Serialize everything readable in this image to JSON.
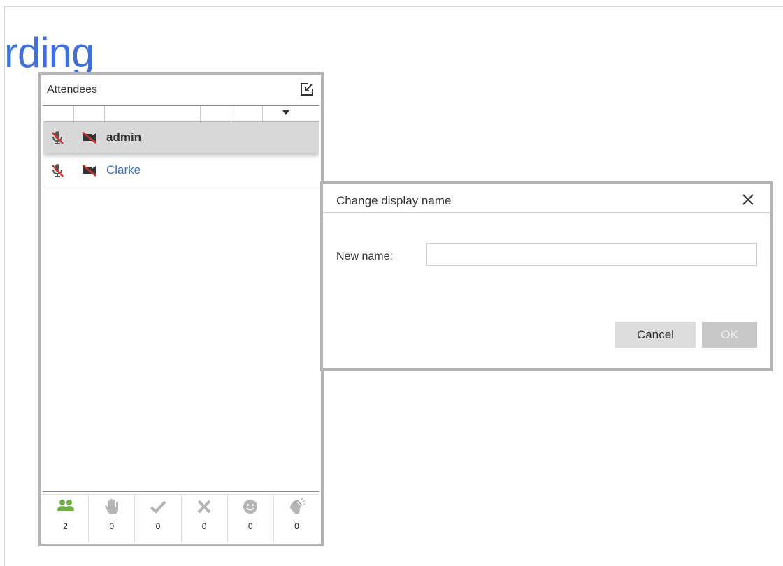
{
  "background": {
    "heading_fragment": "rding"
  },
  "attendees_panel": {
    "title": "Attendees",
    "attendees": [
      {
        "name": "admin",
        "selected": true,
        "mic": "mic-muted",
        "camera": "camera-off"
      },
      {
        "name": "Clarke",
        "selected": false,
        "mic": "mic-muted",
        "camera": "camera-off"
      }
    ],
    "status_counts": [
      {
        "icon": "attendees-icon",
        "count": "2",
        "color": "#6cb33f"
      },
      {
        "icon": "raise-hand-icon",
        "count": "0"
      },
      {
        "icon": "agree-check-icon",
        "count": "0"
      },
      {
        "icon": "disagree-x-icon",
        "count": "0"
      },
      {
        "icon": "smiley-icon",
        "count": "0"
      },
      {
        "icon": "applause-icon",
        "count": "0"
      }
    ]
  },
  "dialog": {
    "title": "Change display name",
    "field_label": "New name:",
    "field_value": "",
    "cancel_label": "Cancel",
    "ok_label": "OK"
  },
  "colors": {
    "accent_blue": "#3f6fd8",
    "link_blue": "#3a6fb7",
    "muted_red": "#d0312d",
    "panel_border": "#b3b3b3"
  }
}
